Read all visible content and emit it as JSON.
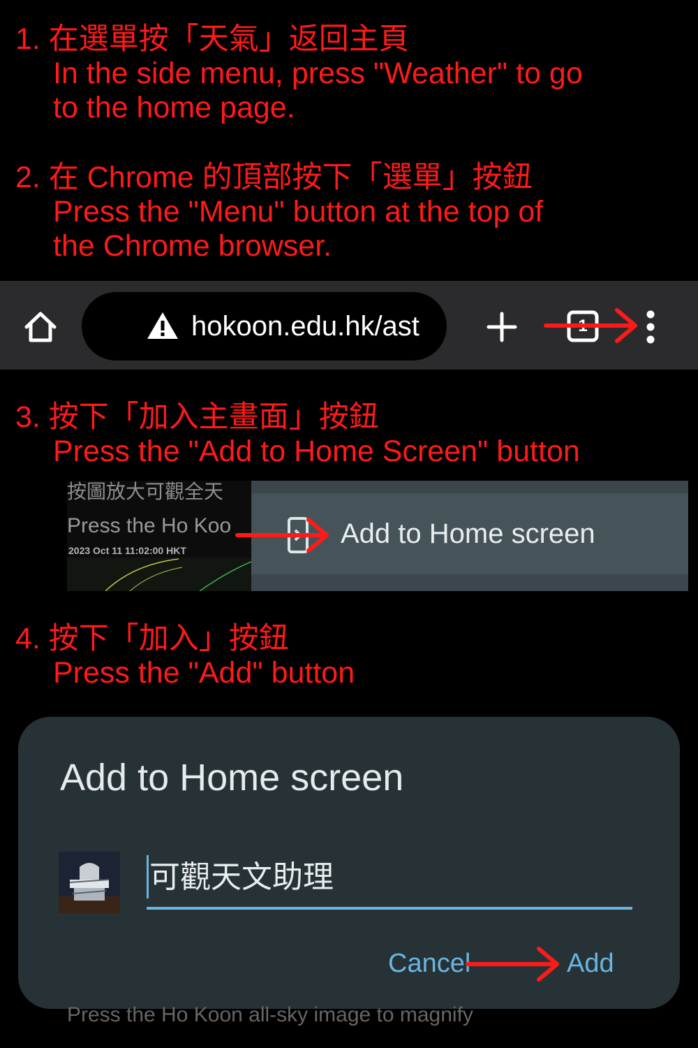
{
  "steps": [
    {
      "zh": "1. 在選單按「天氣」返回主頁",
      "en": [
        "In the side menu, press \"Weather\" to go",
        "to the home page."
      ]
    },
    {
      "zh": "2. 在 Chrome 的頂部按下「選單」按鈕",
      "en": [
        "Press the \"Menu\" button at the top of",
        "the Chrome browser."
      ]
    },
    {
      "zh": "3. 按下「加入主畫面」按鈕",
      "en": [
        "Press the \"Add to Home Screen\" button"
      ]
    },
    {
      "zh": "4. 按下「加入」按鈕",
      "en": [
        "Press the \"Add\" button"
      ]
    }
  ],
  "toolbar": {
    "url": "hokoon.edu.hk/ast",
    "tab_count": "1",
    "icons": [
      "home-icon",
      "warning-icon",
      "plus-icon",
      "tab-switcher-icon",
      "more-vert-icon"
    ]
  },
  "menu_shot": {
    "background_faded_text": "按圖放大可觀全天",
    "background_press_text": "Press the Ho Koo",
    "background_timestamp": "2023 Oct 11  11:02:00 HKT",
    "menu_item": "Add to Home screen",
    "menu_item_icon": "add-to-home-screen-icon"
  },
  "dialog": {
    "title": "Add to Home screen",
    "name_value": "可觀天文助理",
    "cancel_label": "Cancel",
    "add_label": "Add",
    "app_icon": "ho-koon-app-icon"
  },
  "bottom_faded_text": "Press the Ho Koon all-sky image to magnify",
  "colors": {
    "instruction_red": "#ff1a1a",
    "toolbar_bg": "#2b2b2d",
    "dialog_bg": "#273237",
    "accent_blue": "#6ab4e0",
    "arrow_red": "#ff1a1a"
  }
}
